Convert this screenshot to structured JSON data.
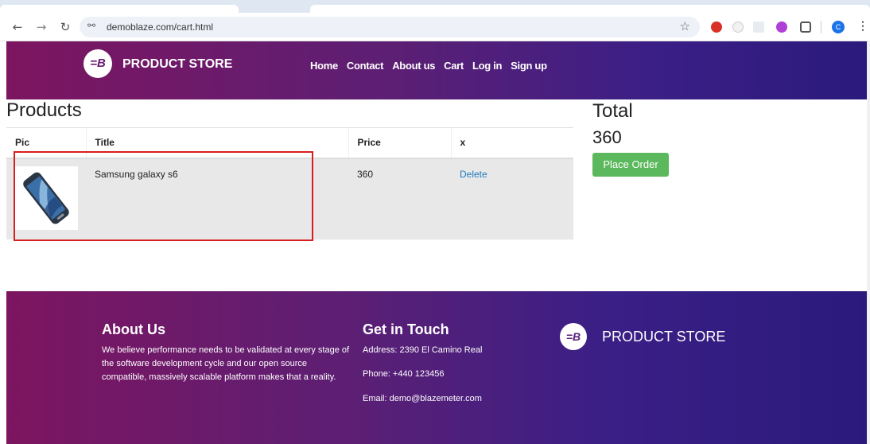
{
  "browser": {
    "url": "demoblaze.com/cart.html",
    "profile_initial": "C",
    "icons": [
      "back-icon",
      "forward-icon",
      "reload-icon",
      "site-info-icon",
      "bookmark-star-icon",
      "extensions-icon",
      "menu-icon"
    ]
  },
  "header": {
    "brand": "PRODUCT STORE",
    "logo_mark": "=B",
    "nav": [
      "Home",
      "Contact",
      "About us",
      "Cart",
      "Log in",
      "Sign up"
    ]
  },
  "cart": {
    "title": "Products",
    "columns": [
      "Pic",
      "Title",
      "Price",
      "x"
    ],
    "rows": [
      {
        "title": "Samsung galaxy s6",
        "price": "360",
        "action": "Delete"
      }
    ],
    "total_label": "Total",
    "total_value": "360",
    "place_order": "Place Order"
  },
  "footer": {
    "about_title": "About Us",
    "about_text": "We believe performance needs to be validated at every stage of the software development cycle and our open source compatible, massively scalable platform makes that a reality.",
    "touch_title": "Get in Touch",
    "address": "Address: 2390 El Camino Real",
    "phone": "Phone: +440 123456",
    "email": "Email: demo@blazemeter.com",
    "brand": "PRODUCT STORE",
    "logo_mark": "=B"
  },
  "colors": {
    "brand_dark": "#7d1560",
    "brand_blue": "#2b1a7c",
    "success": "#5cb85c",
    "link": "#1f7ac0",
    "highlight": "#d71e1e"
  }
}
